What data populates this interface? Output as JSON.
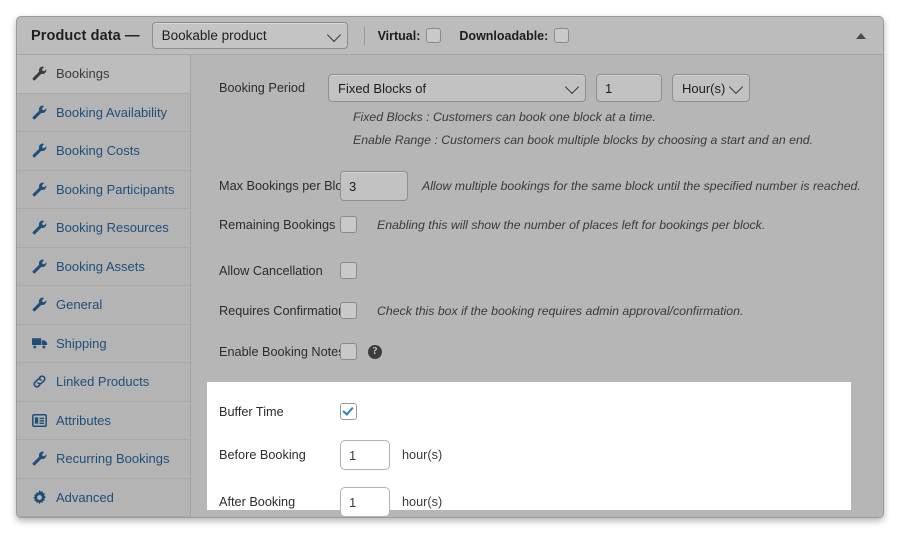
{
  "header": {
    "title": "Product data —",
    "product_type": "Bookable product",
    "product_type_caret": "chevron-down-icon",
    "virtual_label": "Virtual:",
    "virtual_checked": false,
    "downloadable_label": "Downloadable:",
    "downloadable_checked": false,
    "collapse_icon": "triangle-up-icon"
  },
  "sidebar": {
    "items": [
      {
        "label": "Bookings",
        "icon": "wrench-icon",
        "active": true
      },
      {
        "label": "Booking Availability",
        "icon": "wrench-icon",
        "active": false
      },
      {
        "label": "Booking Costs",
        "icon": "wrench-icon",
        "active": false
      },
      {
        "label": "Booking Participants",
        "icon": "wrench-icon",
        "active": false
      },
      {
        "label": "Booking Resources",
        "icon": "wrench-icon",
        "active": false
      },
      {
        "label": "Booking Assets",
        "icon": "wrench-icon",
        "active": false
      },
      {
        "label": "General",
        "icon": "wrench-icon",
        "active": false
      },
      {
        "label": "Shipping",
        "icon": "truck-icon",
        "active": false
      },
      {
        "label": "Linked Products",
        "icon": "link-icon",
        "active": false
      },
      {
        "label": "Attributes",
        "icon": "attributes-icon",
        "active": false
      },
      {
        "label": "Recurring Bookings",
        "icon": "wrench-icon",
        "active": false
      },
      {
        "label": "Advanced",
        "icon": "gear-icon",
        "active": false
      }
    ]
  },
  "form": {
    "booking_period": {
      "label": "Booking Period",
      "mode_value": "Fixed Blocks of",
      "count_value": "1",
      "unit_value": "Hour(s)",
      "hint_fixed": "Fixed Blocks : Customers can book one block at a time.",
      "hint_range": "Enable Range : Customers can book multiple blocks by choosing a start and an end."
    },
    "max_bookings": {
      "label": "Max Bookings per Block",
      "value": "3",
      "hint": "Allow multiple bookings for the same block until the specified number is reached."
    },
    "remaining_bookings": {
      "label": "Remaining Bookings",
      "checked": false,
      "hint": "Enabling this will show the number of places left for bookings per block."
    },
    "allow_cancellation": {
      "label": "Allow Cancellation",
      "checked": false
    },
    "requires_confirmation": {
      "label": "Requires Confirmation",
      "checked": false,
      "hint": "Check this box if the booking requires admin approval/confirmation."
    },
    "enable_booking_notes": {
      "label": "Enable Booking Notes",
      "checked": false,
      "help_icon": "help-circle-icon",
      "help_glyph": "?"
    },
    "buffer_time": {
      "label": "Buffer Time",
      "checked": true
    },
    "before_booking": {
      "label": "Before Booking",
      "value": "1",
      "suffix": "hour(s)"
    },
    "after_booking": {
      "label": "After Booking",
      "value": "1",
      "suffix": "hour(s)"
    }
  },
  "colors": {
    "panel_bg": "#b6b6b6",
    "sidebar_link": "#1f4e79",
    "highlight_bg": "#ffffff",
    "check_accent": "#2a7fc4"
  }
}
